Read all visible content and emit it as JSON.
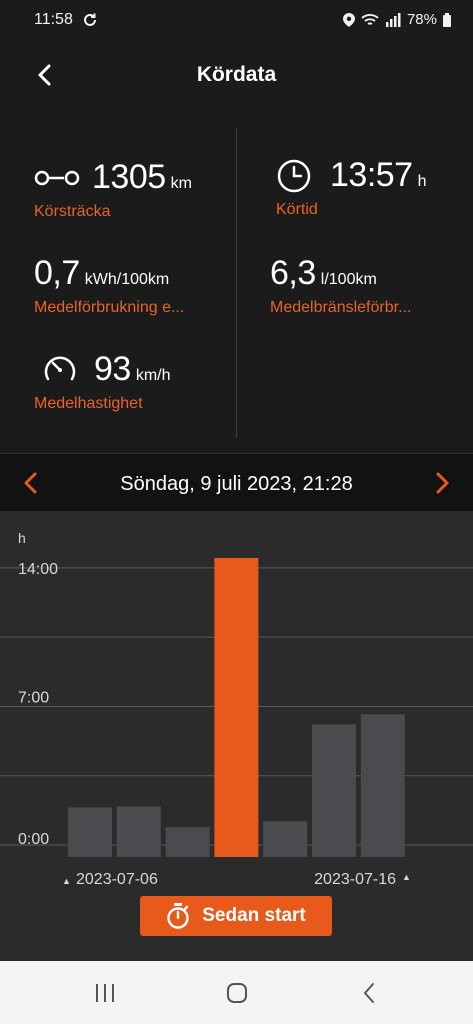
{
  "status_bar": {
    "time": "11:58",
    "battery": "78%"
  },
  "header": {
    "title": "Kördata"
  },
  "stats": {
    "distance": {
      "value": "1305",
      "unit": "km",
      "label": "Körsträcka"
    },
    "drive_time": {
      "value": "13:57",
      "unit": "h",
      "label": "Körtid"
    },
    "consumption_electric": {
      "value": "0,7",
      "unit": "kWh/100km",
      "label": "Medelförbrukning e..."
    },
    "consumption_fuel": {
      "value": "6,3",
      "unit": "l/100km",
      "label": "Medelbränsleförbr..."
    },
    "avg_speed": {
      "value": "93",
      "unit": "km/h",
      "label": "Medelhastighet"
    }
  },
  "date_nav": {
    "date": "Söndag, 9 juli 2023, 21:28"
  },
  "chart_data": {
    "type": "bar",
    "ylabel": "h",
    "ytick_labels": [
      "14:00",
      "7:00",
      "0:00"
    ],
    "ylim": [
      0,
      14.5
    ],
    "start_date_label": "2023-07-06",
    "end_date_label": "2023-07-16",
    "values": [
      1.9,
      1.95,
      0.9,
      14.5,
      1.2,
      6.1,
      6.6
    ],
    "highlight_index": 3,
    "bar_color": "#4a4b4e",
    "highlight_color": "#e85a1c"
  },
  "start_button": {
    "label": "Sedan start"
  },
  "colors": {
    "accent": "#e85a1c",
    "label_orange": "#e8632a"
  }
}
